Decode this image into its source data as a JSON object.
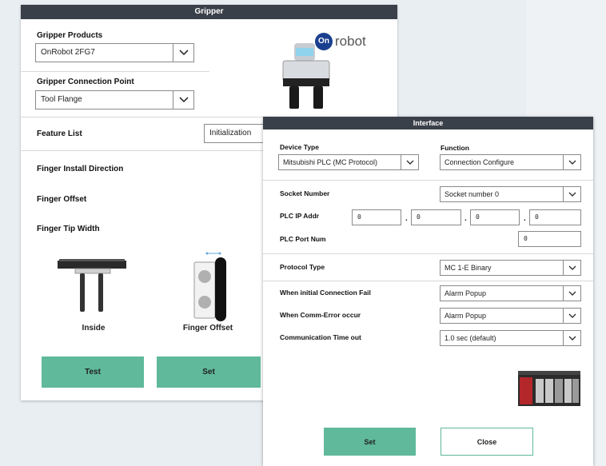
{
  "gripper_window": {
    "title": "Gripper",
    "products_label": "Gripper Products",
    "products_value": "OnRobot 2FG7",
    "connection_label": "Gripper Connection Point",
    "connection_value": "Tool Flange",
    "feature_list_label": "Feature List",
    "feature_list_value": "Initialization",
    "finger_install_direction_label": "Finger Install Direction",
    "finger_offset_label": "Finger Offset",
    "finger_tip_width_label": "Finger Tip Width",
    "caption_inside": "Inside",
    "caption_finger_offset": "Finger Offset",
    "test_button": "Test",
    "set_button": "Set",
    "brand_logo_text": "robot",
    "brand_logo_mark": "On"
  },
  "interface_window": {
    "title": "Interface",
    "device_type_label": "Device Type",
    "device_type_value": "Mitsubishi PLC (MC Protocol)",
    "function_label": "Function",
    "function_value": "Connection Configure",
    "socket_number_label": "Socket Number",
    "socket_number_value": "Socket number 0",
    "plc_ip_label": "PLC IP Addr",
    "ip_octets": [
      "0",
      "0",
      "0",
      "0"
    ],
    "ip_separator": ".",
    "plc_port_label": "PLC Port Num",
    "plc_port_value": "0",
    "protocol_type_label": "Protocol Type",
    "protocol_type_value": "MC 1-E Binary",
    "initial_conn_fail_label": "When initial Connection Fail",
    "initial_conn_fail_value": "Alarm Popup",
    "comm_error_label": "When Comm-Error occur",
    "comm_error_value": "Alarm Popup",
    "comm_timeout_label": "Communication Time out",
    "comm_timeout_value": "1.0 sec (default)",
    "set_button": "Set",
    "close_button": "Close"
  },
  "colors": {
    "titlebar": "#3a404a",
    "accent_green": "#5fb99a",
    "background": "#e9eef2"
  }
}
